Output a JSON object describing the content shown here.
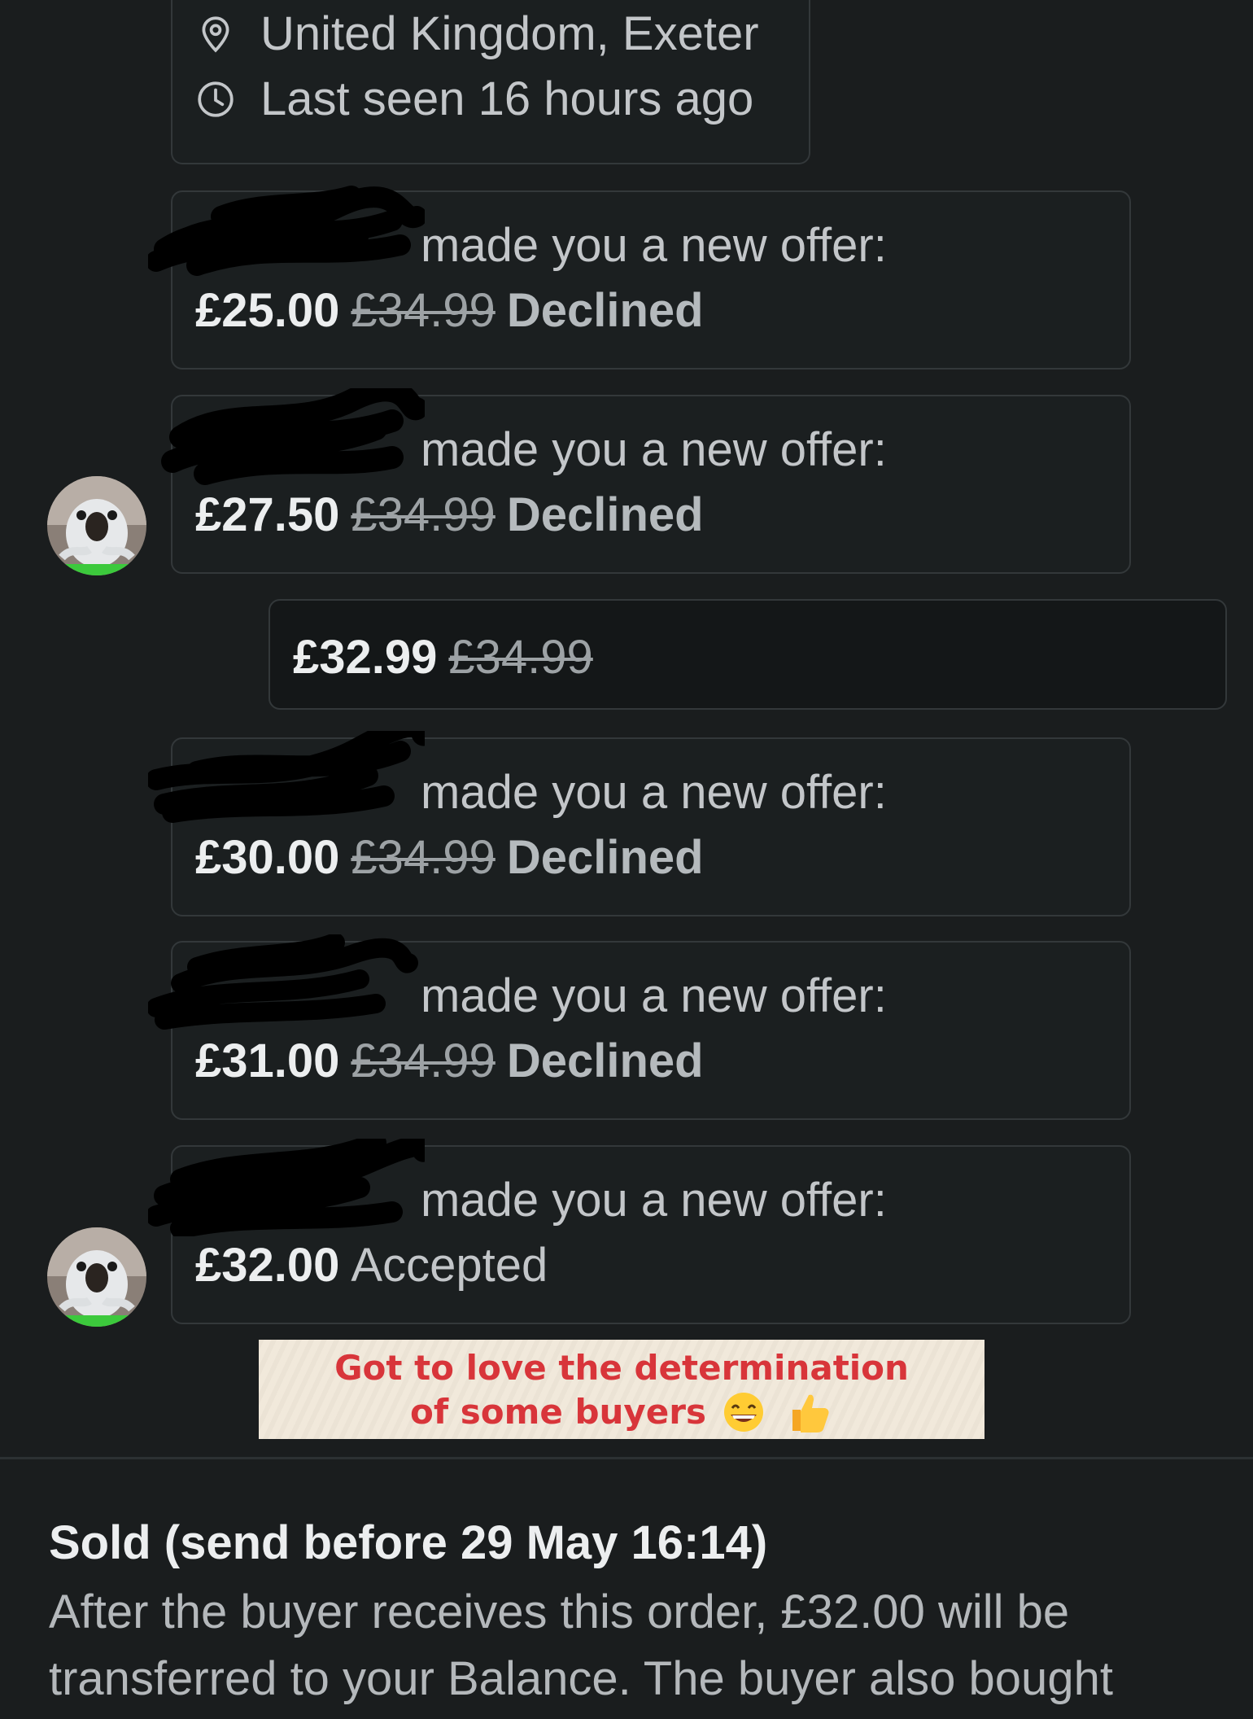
{
  "profile": {
    "location": "United Kingdom, Exeter",
    "last_seen": "Last seen 16 hours ago"
  },
  "offers": [
    {
      "text": "made you a new offer:",
      "amount": "£25.00",
      "original": "£34.99",
      "status": "Declined"
    },
    {
      "text": "made you a new offer:",
      "amount": "£27.50",
      "original": "£34.99",
      "status": "Declined"
    },
    {
      "text": "made you a new offer:",
      "amount": "£30.00",
      "original": "£34.99",
      "status": "Declined"
    },
    {
      "text": "made you a new offer:",
      "amount": "£31.00",
      "original": "£34.99",
      "status": "Declined"
    },
    {
      "text": "made you a new offer:",
      "amount": "£32.00",
      "status": "Accepted"
    }
  ],
  "seller_counter": {
    "amount": "£32.99",
    "original": "£34.99"
  },
  "banner": {
    "line1": "Got to love the determination",
    "line2": "of some buyers",
    "emojis": [
      "grinning-face-icon",
      "thumbs-up-icon"
    ]
  },
  "order_status": {
    "title": "Sold (send before 29 May 16:14)",
    "body": "After the buyer receives this order, £32.00 will be transferred to your Balance. The buyer also bought"
  },
  "colors": {
    "background": "#1a1d1e",
    "card_border": "#33383a",
    "banner_bg": "#f1e8da",
    "banner_text": "#d8353a"
  }
}
